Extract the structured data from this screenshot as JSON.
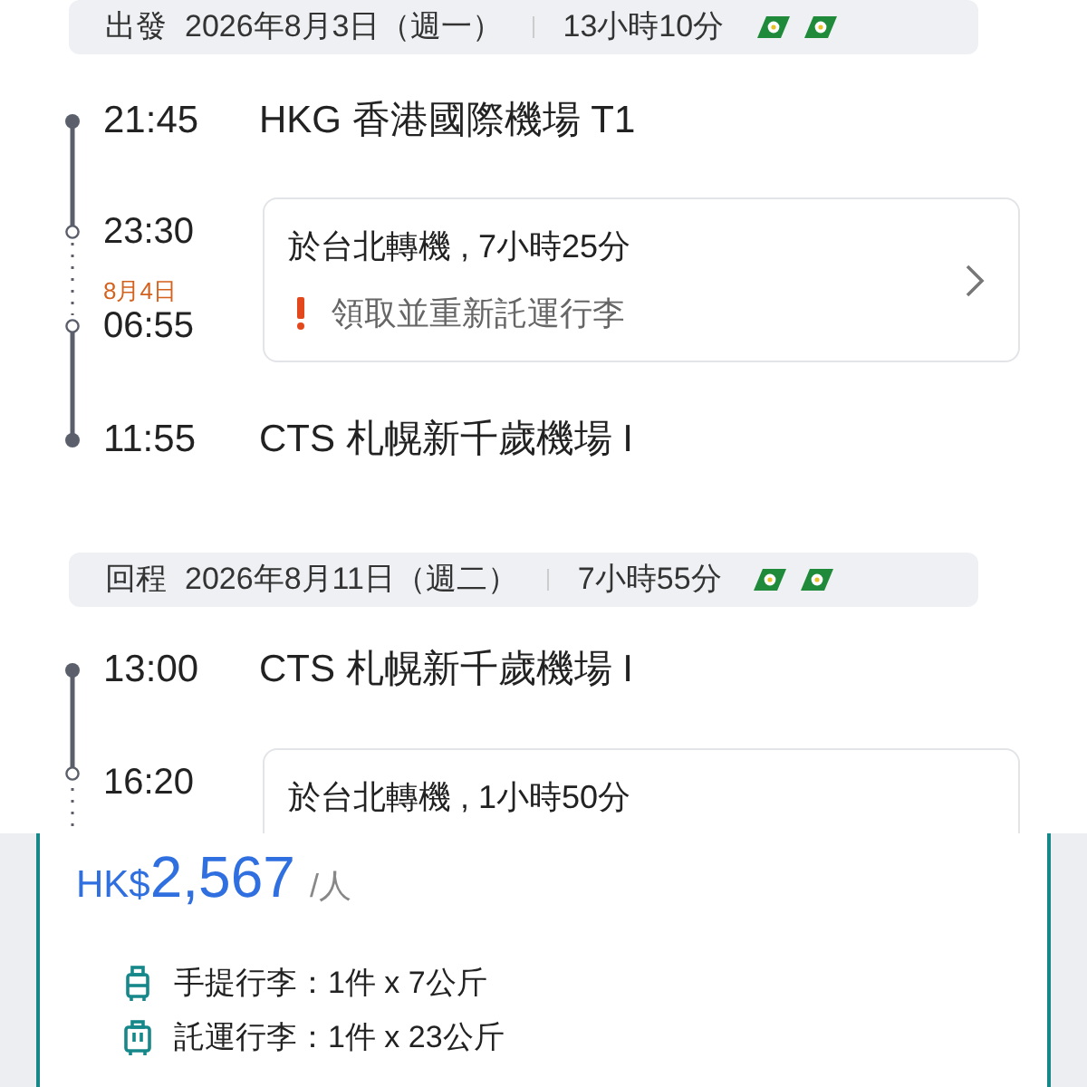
{
  "legs": [
    {
      "label": "出發",
      "date": "2026年8月3日（週一）",
      "duration": "13小時10分",
      "departure": {
        "time": "21:45",
        "airport": "HKG 香港國際機場 T1"
      },
      "transfer": {
        "arrive_time": "23:30",
        "next_day": "8月4日",
        "depart_time": "06:55",
        "text": "於台北轉機 , 7小時25分",
        "warning": "領取並重新託運行李"
      },
      "arrival": {
        "time": "11:55",
        "airport": "CTS 札幌新千歲機場 I"
      }
    },
    {
      "label": "回程",
      "date": "2026年8月11日（週二）",
      "duration": "7小時55分",
      "departure": {
        "time": "13:00",
        "airport": "CTS 札幌新千歲機場 I"
      },
      "transfer": {
        "arrive_time": "16:20",
        "text": "於台北轉機 , 1小時50分"
      }
    }
  ],
  "price": {
    "currency": "HK$",
    "amount": "2,567",
    "unit": "/人"
  },
  "baggage": [
    {
      "kind": "carry_on",
      "text": "手提行李：1件 x 7公斤"
    },
    {
      "kind": "checked",
      "text": "託運行李：1件 x 23公斤"
    }
  ]
}
